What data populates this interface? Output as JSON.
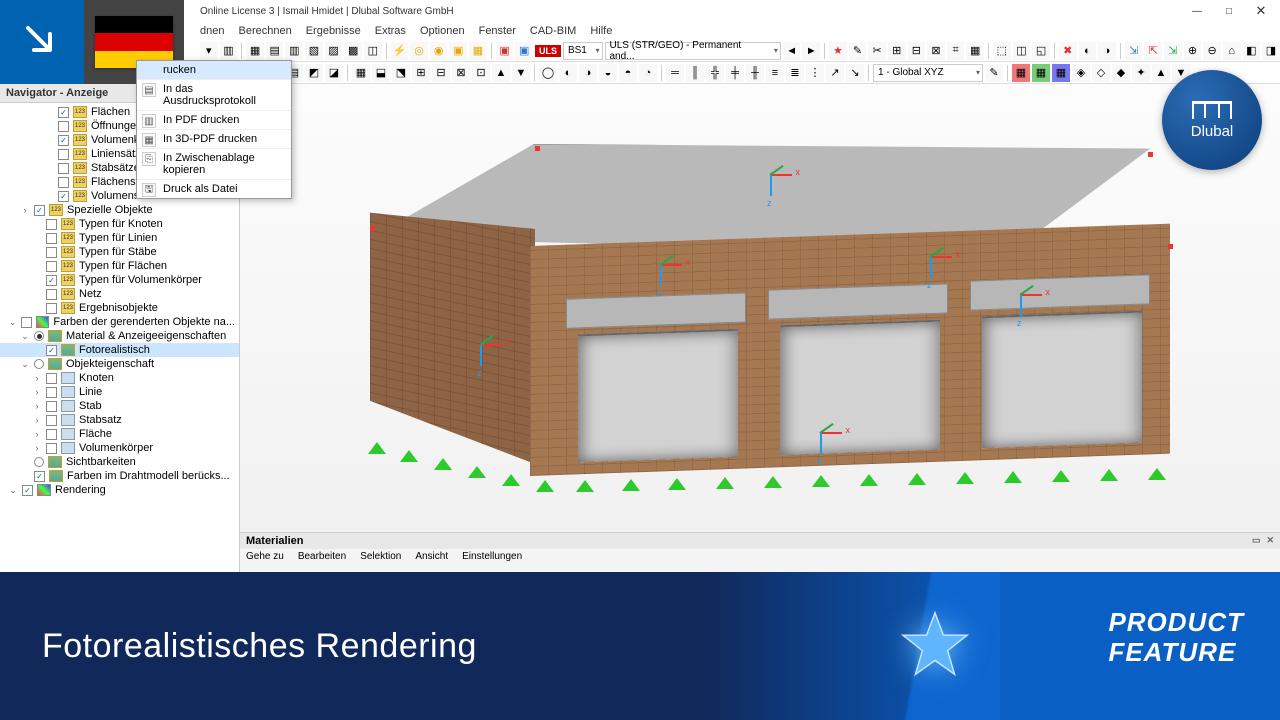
{
  "window": {
    "license_text": "Online License 3 | Ismail Hmidet | Dlubal Software GmbH",
    "min": "—",
    "max": "□",
    "close": "✕"
  },
  "menu": {
    "items": [
      "dnen",
      "Berechnen",
      "Ergebnisse",
      "Extras",
      "Optionen",
      "Fenster",
      "CAD-BIM",
      "Hilfe"
    ]
  },
  "toolbar": {
    "uls_tag": "ULS",
    "combo1": "BS1",
    "combo2": "ULS (STR/GEO) - Permanent and...",
    "coord": "1 - Global XYZ"
  },
  "context_menu": {
    "header": "rucken",
    "items": [
      "In das Ausdrucksprotokoll",
      "In PDF drucken",
      "In 3D-PDF drucken",
      "In Zwischenablage kopieren",
      "Druck als Datei"
    ]
  },
  "navigator": {
    "title": "Navigator - Anzeige",
    "items": [
      {
        "indent": 3,
        "cb": true,
        "checked": true,
        "ico": "num",
        "label": "Flächen"
      },
      {
        "indent": 3,
        "cb": true,
        "checked": false,
        "ico": "num",
        "label": "Öffnungen"
      },
      {
        "indent": 3,
        "cb": true,
        "checked": true,
        "ico": "num",
        "label": "Volumenkörp"
      },
      {
        "indent": 3,
        "cb": true,
        "checked": false,
        "ico": "num",
        "label": "Liniensätze"
      },
      {
        "indent": 3,
        "cb": true,
        "checked": false,
        "ico": "num",
        "label": "Stabsätze"
      },
      {
        "indent": 3,
        "cb": true,
        "checked": false,
        "ico": "num",
        "label": "Flächensätze"
      },
      {
        "indent": 3,
        "cb": true,
        "checked": true,
        "ico": "num",
        "label": "Volumensätze"
      },
      {
        "indent": 1,
        "exp": ">",
        "cb": true,
        "checked": true,
        "ico": "num",
        "label": "Spezielle Objekte"
      },
      {
        "indent": 2,
        "cb": true,
        "checked": false,
        "ico": "num",
        "label": "Typen für Knoten"
      },
      {
        "indent": 2,
        "cb": true,
        "checked": false,
        "ico": "num",
        "label": "Typen für Linien"
      },
      {
        "indent": 2,
        "cb": true,
        "checked": false,
        "ico": "num",
        "label": "Typen für Stäbe"
      },
      {
        "indent": 2,
        "cb": true,
        "checked": false,
        "ico": "num",
        "label": "Typen für Flächen"
      },
      {
        "indent": 2,
        "cb": true,
        "checked": true,
        "ico": "num",
        "label": "Typen für Volumenkörper"
      },
      {
        "indent": 2,
        "cb": true,
        "checked": false,
        "ico": "num",
        "label": "Netz"
      },
      {
        "indent": 2,
        "cb": true,
        "checked": false,
        "ico": "num",
        "label": "Ergebnisobjekte"
      },
      {
        "indent": 0,
        "exp": "v",
        "cb": true,
        "checked": false,
        "ico": "color",
        "label": "Farben der gerenderten Objekte na..."
      },
      {
        "indent": 1,
        "exp": "v",
        "radio": true,
        "ron": true,
        "ico": "mat",
        "label": "Material & Anzeigeeigenschaften"
      },
      {
        "indent": 2,
        "cb": true,
        "checked": true,
        "ico": "mat",
        "label": "Fotorealistisch",
        "selected": true
      },
      {
        "indent": 1,
        "exp": "v",
        "radio": true,
        "ron": false,
        "ico": "mat",
        "label": "Objekteigenschaft"
      },
      {
        "indent": 2,
        "exp": ">",
        "cb": true,
        "checked": false,
        "ico": "box",
        "label": "Knoten"
      },
      {
        "indent": 2,
        "exp": ">",
        "cb": true,
        "checked": false,
        "ico": "box",
        "label": "Linie"
      },
      {
        "indent": 2,
        "exp": ">",
        "cb": true,
        "checked": false,
        "ico": "box",
        "label": "Stab"
      },
      {
        "indent": 2,
        "exp": ">",
        "cb": true,
        "checked": false,
        "ico": "box",
        "label": "Stabsatz"
      },
      {
        "indent": 2,
        "exp": ">",
        "cb": true,
        "checked": false,
        "ico": "box",
        "label": "Fläche"
      },
      {
        "indent": 2,
        "exp": ">",
        "cb": true,
        "checked": false,
        "ico": "box",
        "label": "Volumenkörper"
      },
      {
        "indent": 1,
        "radio": true,
        "ron": false,
        "ico": "mat",
        "label": "Sichtbarkeiten"
      },
      {
        "indent": 1,
        "cb": true,
        "checked": true,
        "ico": "mat",
        "label": "Farben im Drahtmodell berücks..."
      },
      {
        "indent": 0,
        "exp": "v",
        "cb": true,
        "checked": true,
        "ico": "color",
        "label": "Rendering"
      }
    ]
  },
  "materials_panel": {
    "title": "Materialien",
    "menu": [
      "Gehe zu",
      "Bearbeiten",
      "Selektion",
      "Ansicht",
      "Einstellungen"
    ]
  },
  "logo": {
    "label": "Dlubal"
  },
  "banner": {
    "left": "Fotorealistisches Rendering",
    "right1": "PRODUCT",
    "right2": "FEATURE"
  }
}
